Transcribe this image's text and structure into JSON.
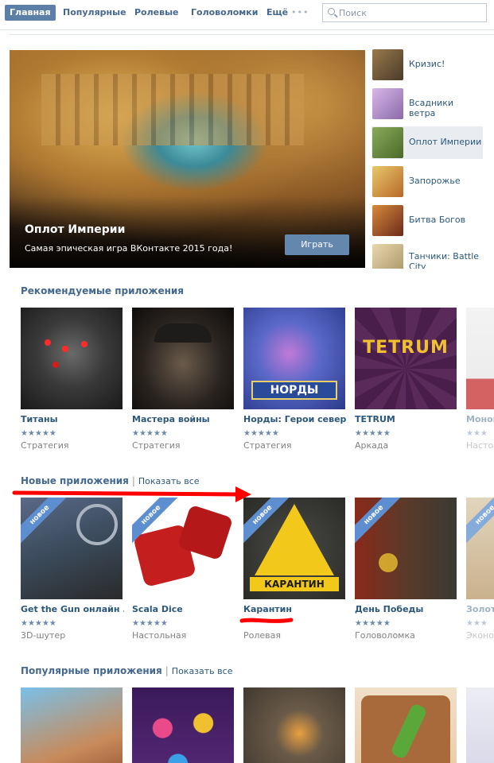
{
  "nav": {
    "tabs": [
      "Главная",
      "Популярные",
      "Ролевые",
      "Головоломки",
      "Ещё"
    ],
    "more_dots": "•••",
    "search_placeholder": "Поиск"
  },
  "banner": {
    "title": "Оплот Империи",
    "subtitle": "Самая эпическая игра ВКонтакте 2015 года!",
    "play_label": "Играть"
  },
  "side_list": [
    {
      "label": "Кризис!",
      "color": "#7a5a3a"
    },
    {
      "label": "Всадники ветра",
      "color": "#b89ac8"
    },
    {
      "label": "Оплот Империи",
      "color": "#6a8a4a"
    },
    {
      "label": "Запорожье",
      "color": "#c8a24a"
    },
    {
      "label": "Битва Богов",
      "color": "#a05a2a"
    },
    {
      "label": "Танчики: Battle City",
      "color": "#c8b48a"
    }
  ],
  "recommended": {
    "title": "Рекомендуемые приложения",
    "apps": [
      {
        "name": "Титаны",
        "rating": "★★★★★",
        "category": "Стратегия"
      },
      {
        "name": "Мастера войны",
        "rating": "★★★★★",
        "category": "Стратегия"
      },
      {
        "name": "Норды: Герои севера",
        "rating": "★★★★★",
        "category": "Стратегия"
      },
      {
        "name": "TETRUM",
        "rating": "★★★★★",
        "category": "Аркада"
      },
      {
        "name": "Монопо",
        "rating": "★★★",
        "category": "Настол"
      }
    ],
    "tetrum_logo": "TETRUM"
  },
  "new_apps": {
    "title": "Новые приложения",
    "show_all": "Показать все",
    "badge": "новое",
    "apps": [
      {
        "name": "Get the Gun онлайн ...",
        "rating": "★★★★★",
        "category": "3D-шутер"
      },
      {
        "name": "Scala Dice",
        "rating": "★★★★★",
        "category": "Настольная"
      },
      {
        "name": "Карантин",
        "rating": "",
        "category": "Ролевая"
      },
      {
        "name": "День Победы",
        "rating": "★★★★★",
        "category": "Головоломка"
      },
      {
        "name": "Золото",
        "rating": "★★★",
        "category": "Экономи"
      }
    ],
    "karantin_logo": "КАРАНТИН"
  },
  "popular": {
    "title": "Популярные приложения",
    "show_all": "Показать все"
  },
  "colors": {
    "link": "#2b587a",
    "heading": "#45688e",
    "accent": "#5b7fa6",
    "annotation_red": "#ff0000"
  }
}
